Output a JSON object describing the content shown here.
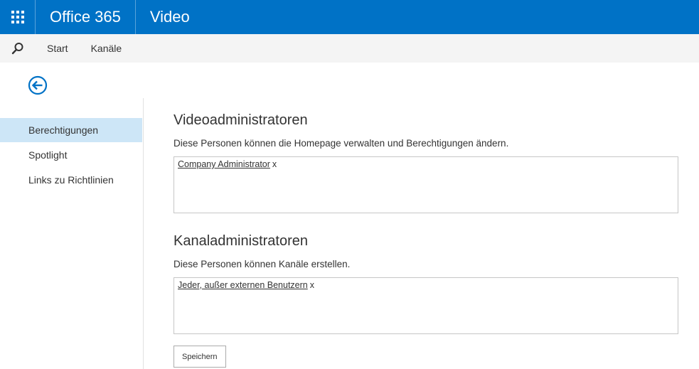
{
  "suitebar": {
    "brand": "Office 365",
    "app_name": "Video",
    "waffle_icon": "app-launcher-icon"
  },
  "command_bar": {
    "search_icon": "search-icon",
    "links": [
      {
        "label": "Start"
      },
      {
        "label": "Kanäle"
      }
    ]
  },
  "back_icon": "back-arrow-icon",
  "left_nav": {
    "items": [
      {
        "label": "Berechtigungen",
        "active": true
      },
      {
        "label": "Spotlight",
        "active": false
      },
      {
        "label": "Links zu Richtlinien",
        "active": false
      }
    ]
  },
  "main": {
    "video_admins": {
      "title": "Videoadministratoren",
      "description": "Diese Personen können die Homepage verwalten und Berechtigungen ändern.",
      "people": [
        {
          "name": "Company Administrator",
          "remove": "x"
        }
      ]
    },
    "channel_admins": {
      "title": "Kanaladministratoren",
      "description": "Diese Personen können Kanäle erstellen.",
      "people": [
        {
          "name": "Jeder, außer externen Benutzern",
          "remove": "x"
        }
      ]
    },
    "save_label": "Speichern"
  },
  "colors": {
    "suitebar_bg": "#0072c6",
    "command_bar_bg": "#f4f4f4",
    "active_nav_bg": "#cde6f7",
    "accent": "#0072c6"
  }
}
